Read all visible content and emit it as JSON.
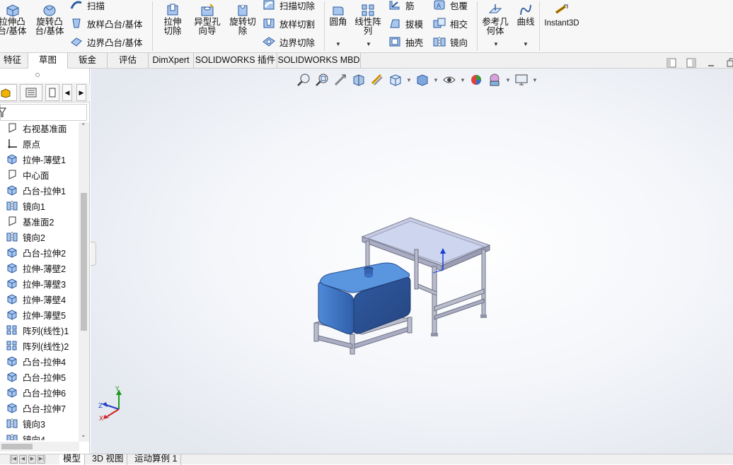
{
  "ribbon": {
    "extrude_boss": "拉伸凸台/基体",
    "revolve_boss": "旋转凸台/基体",
    "sweep": "扫描",
    "loft_boss": "放样凸台/基体",
    "boundary_boss": "边界凸台/基体",
    "extrude_cut": "拉伸切除",
    "hole_wizard": "异型孔向导",
    "revolve_cut": "旋转切除",
    "sweep_cut": "扫描切除",
    "loft_cut": "放样切割",
    "boundary_cut": "边界切除",
    "fillet": "圆角",
    "linear_pattern": "线性阵列",
    "rib": "筋",
    "draft": "拔模",
    "shell": "抽壳",
    "wrap": "包覆",
    "intersect": "相交",
    "mirror": "镜向",
    "ref_geometry": "参考几何体",
    "curves": "曲线",
    "instant3d": "Instant3D"
  },
  "command_tabs": [
    "特征",
    "草图",
    "钣金",
    "评估",
    "DimXpert",
    "SOLIDWORKS 插件",
    "SOLIDWORKS MBD"
  ],
  "tree": [
    {
      "label": "右视基准面",
      "icon": "plane-icon"
    },
    {
      "label": "原点",
      "icon": "origin-icon"
    },
    {
      "label": "拉伸-薄壁1",
      "icon": "feature-icon"
    },
    {
      "label": "中心面",
      "icon": "plane-icon"
    },
    {
      "label": "凸台-拉伸1",
      "icon": "feature-icon"
    },
    {
      "label": "镜向1",
      "icon": "mirror-icon"
    },
    {
      "label": "基准面2",
      "icon": "plane-icon"
    },
    {
      "label": "镜向2",
      "icon": "mirror-icon"
    },
    {
      "label": "凸台-拉伸2",
      "icon": "feature-icon"
    },
    {
      "label": "拉伸-薄壁2",
      "icon": "feature-icon"
    },
    {
      "label": "拉伸-薄壁3",
      "icon": "feature-icon"
    },
    {
      "label": "拉伸-薄壁4",
      "icon": "feature-icon"
    },
    {
      "label": "拉伸-薄壁5",
      "icon": "feature-icon"
    },
    {
      "label": "阵列(线性)1",
      "icon": "pattern-icon"
    },
    {
      "label": "阵列(线性)2",
      "icon": "pattern-icon"
    },
    {
      "label": "凸台-拉伸4",
      "icon": "feature-icon"
    },
    {
      "label": "凸台-拉伸5",
      "icon": "feature-icon"
    },
    {
      "label": "凸台-拉伸6",
      "icon": "feature-icon"
    },
    {
      "label": "凸台-拉伸7",
      "icon": "feature-icon"
    },
    {
      "label": "镜向3",
      "icon": "mirror-icon"
    },
    {
      "label": "镜向4",
      "icon": "mirror-icon"
    }
  ],
  "triad": {
    "x": "X",
    "y": "Y",
    "z": "Z"
  },
  "bottom_tabs": [
    "模型",
    "3D 视图",
    "运动算例 1"
  ],
  "colors": {
    "model_blue": "#3a6fc4",
    "frame_grey": "#b9bccb",
    "accent": "#1f5fbf"
  }
}
